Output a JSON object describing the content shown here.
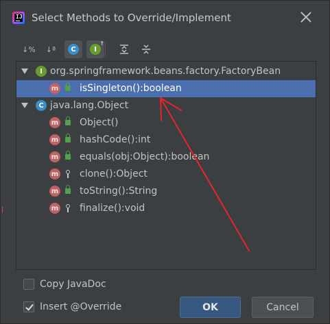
{
  "window": {
    "title": "Select Methods to Override/Implement",
    "logo_text": "IJ"
  },
  "toolbar": {
    "items": [
      {
        "icon": "sort-by-visibility-icon",
        "glyph": "↓%"
      },
      {
        "icon": "sort-alphabetically-icon",
        "glyph": "↓ª"
      },
      {
        "icon": "show-classes-icon",
        "glyph": "C"
      },
      {
        "icon": "show-interfaces-icon",
        "glyph": "I"
      },
      {
        "icon": "expand-all-icon",
        "glyph": "⇕"
      },
      {
        "icon": "collapse-all-icon",
        "glyph": "⇔"
      }
    ]
  },
  "tree": {
    "groups": [
      {
        "badge": "I",
        "name": "org.springframework.beans.factory.FactoryBean",
        "methods": [
          {
            "badge": "m",
            "access": "public",
            "signature": "isSingleton():boolean",
            "selected": true
          }
        ]
      },
      {
        "badge": "C",
        "name": "java.lang.Object",
        "methods": [
          {
            "badge": "m",
            "access": "public",
            "signature": "Object()",
            "selected": false
          },
          {
            "badge": "m",
            "access": "public",
            "signature": "hashCode():int",
            "selected": false
          },
          {
            "badge": "m",
            "access": "public",
            "signature": "equals(obj:Object):boolean",
            "selected": false
          },
          {
            "badge": "m",
            "access": "protected",
            "signature": "clone():Object",
            "selected": false
          },
          {
            "badge": "m",
            "access": "public",
            "signature": "toString():String",
            "selected": false
          },
          {
            "badge": "m",
            "access": "protected",
            "signature": "finalize():void",
            "selected": false
          }
        ]
      }
    ]
  },
  "options": {
    "copy_javadoc": {
      "label": "Copy JavaDoc",
      "checked": false
    },
    "insert_override": {
      "label": "Insert @Override",
      "checked": true
    }
  },
  "buttons": {
    "ok": "OK",
    "cancel": "Cancel"
  },
  "colors": {
    "background": "#3c3f41",
    "selection": "#4b6eaf",
    "annotation_arrow": "#e8242a"
  }
}
